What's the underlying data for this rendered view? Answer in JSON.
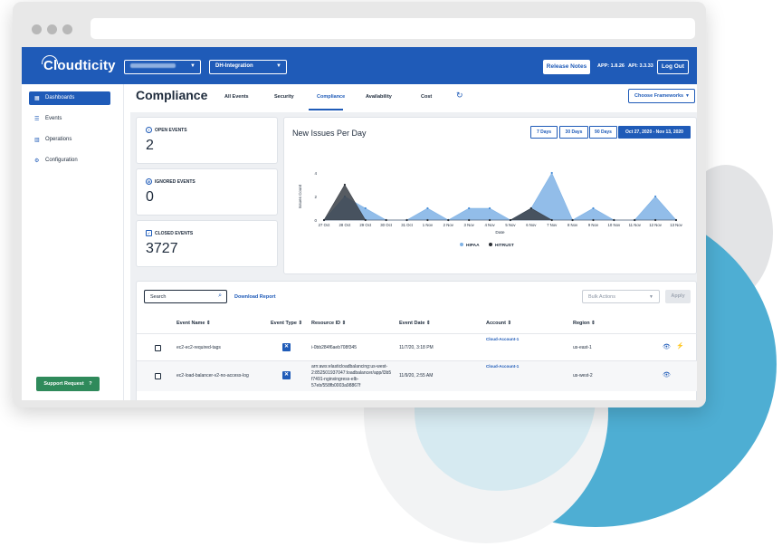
{
  "topbar": {
    "logo": "Cloudticity",
    "account_select": "",
    "env_select": "DH-Integration",
    "release_notes": "Release Notes",
    "app_version": "APP: 1.8.26",
    "api_version": "API: 3.3.33",
    "logout": "Log Out"
  },
  "sidebar": {
    "items": [
      {
        "label": "Dashboards",
        "icon": "dashboard-icon",
        "active": true
      },
      {
        "label": "Events",
        "icon": "list-icon"
      },
      {
        "label": "Operations",
        "icon": "bar-chart-icon"
      },
      {
        "label": "Configuration",
        "icon": "config-icon"
      }
    ],
    "support": "Support Request",
    "support_icon": "?"
  },
  "header": {
    "title": "Compliance",
    "tabs": [
      "All Events",
      "Security",
      "Compliance",
      "Availability",
      "Cost"
    ],
    "active_tab": "Compliance",
    "frameworks": "Choose Frameworks"
  },
  "stats": [
    {
      "label": "OPEN EVENTS",
      "value": "2",
      "icon": "warning-icon"
    },
    {
      "label": "IGNORED EVENTS",
      "value": "0",
      "icon": "ignore-icon"
    },
    {
      "label": "CLOSED EVENTS",
      "value": "3727",
      "icon": "check-icon"
    }
  ],
  "chart": {
    "title": "New Issues Per Day",
    "ranges": [
      "7 Days",
      "30 Days",
      "90 Days",
      "Oct 27, 2020 - Nov 13, 2020"
    ],
    "active_range": 3
  },
  "chart_data": {
    "type": "area",
    "title": "New Issues Per Day",
    "xlabel": "Date",
    "ylabel": "Issues Count",
    "ylim": [
      0,
      4
    ],
    "yticks": [
      "0",
      "2",
      "4"
    ],
    "categories": [
      "27 Oct",
      "28 Oct",
      "29 Oct",
      "30 Oct",
      "31 Oct",
      "1 Nov",
      "2 Nov",
      "3 Nov",
      "4 Nov",
      "5 Nov",
      "6 Nov",
      "7 Nov",
      "8 Nov",
      "9 Nov",
      "10 Nov",
      "11 Nov",
      "12 Nov",
      "13 Nov"
    ],
    "series": [
      {
        "name": "HIPAA",
        "color": "#7fb2e5",
        "values": [
          0,
          2,
          1,
          0,
          0,
          1,
          0,
          1,
          1,
          0,
          1,
          4,
          0,
          1,
          0,
          0,
          2,
          0
        ]
      },
      {
        "name": "HITRUST",
        "color": "#3a3f47",
        "values": [
          0,
          3,
          0,
          0,
          0,
          0,
          0,
          0,
          0,
          0,
          1,
          0,
          0,
          0,
          0,
          0,
          0,
          0
        ]
      }
    ],
    "legend": "bottom"
  },
  "table": {
    "search_placeholder": "Search",
    "download": "Download Report",
    "bulk_actions": "Bulk Actions",
    "apply": "Apply",
    "headers": [
      "Event Name",
      "Event Type",
      "Resource ID",
      "Event Date",
      "Account",
      "Region"
    ],
    "rows": [
      {
        "event_name": "ec2-ec2-required-tags",
        "resource_id": "i-0bb284f6aeb708f345",
        "event_date": "11/7/20, 3:18 PM",
        "account": "Cloud-Account-1",
        "region": "us-east-1"
      },
      {
        "event_name": "ec2-load-balancer-v2-no-access-log",
        "resource_id_lines": [
          "arn:aws:elasticloadbalancing:us-west-",
          "2:852501937047:loadbalancer/app/l3b5",
          "f7491-nginxingress-elb-",
          "57eb/558fb0003a98867f"
        ],
        "event_date": "11/9/20, 2:55 AM",
        "account": "Cloud-Account-1",
        "region": "us-west-2"
      }
    ]
  }
}
